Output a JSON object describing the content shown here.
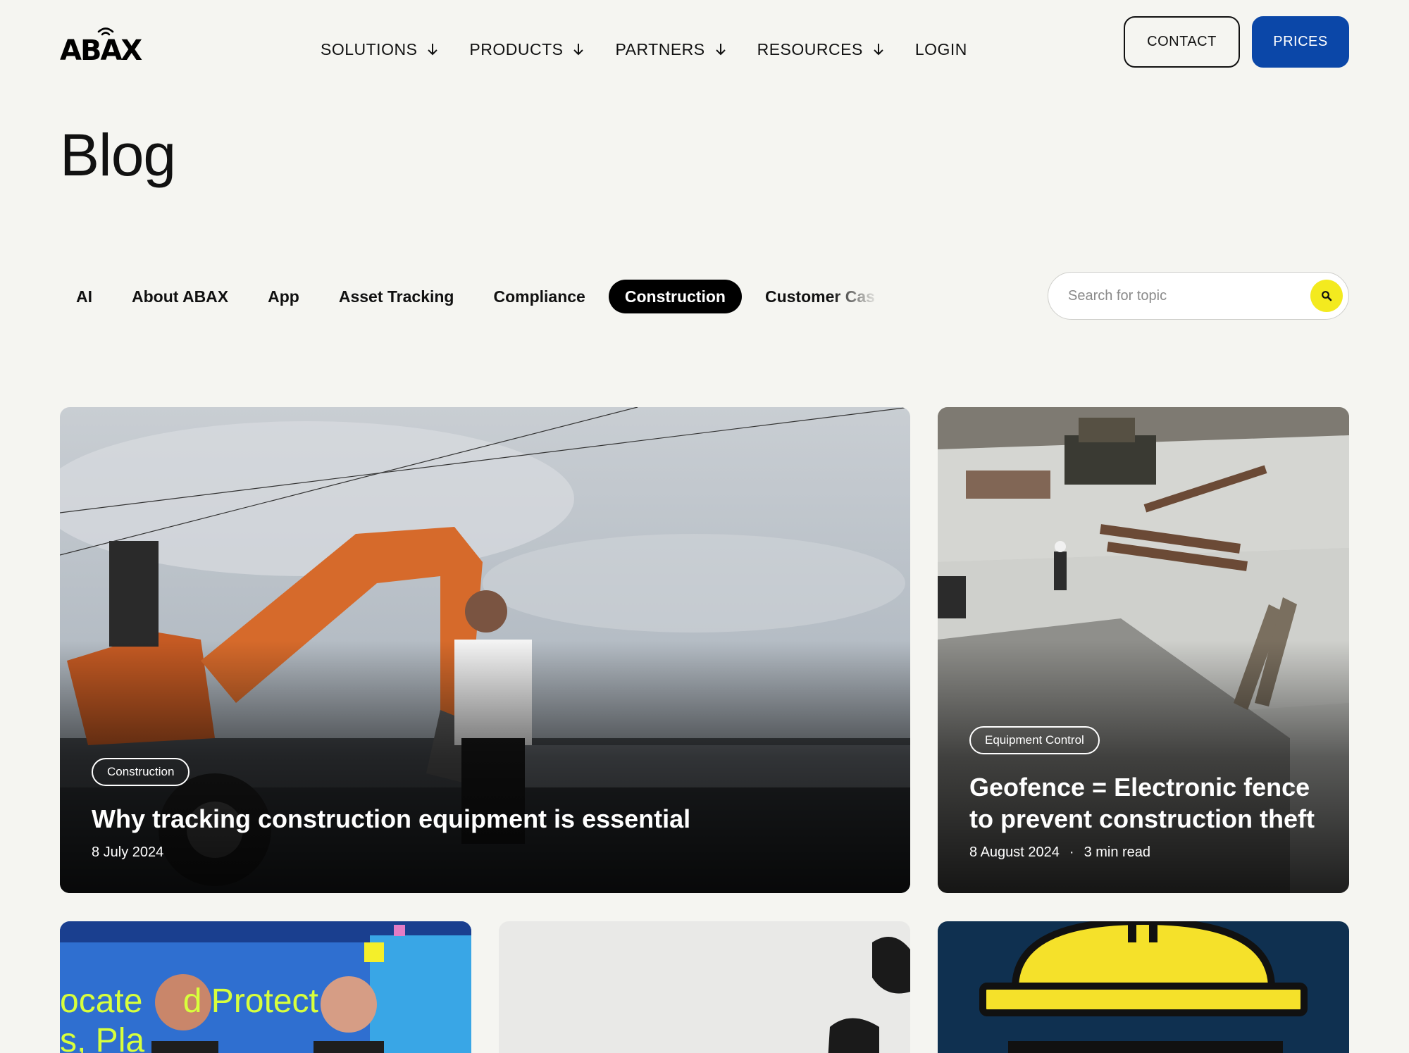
{
  "header": {
    "logo_text": "ABAX",
    "nav": [
      {
        "label": "SOLUTIONS",
        "has_dropdown": true
      },
      {
        "label": "PRODUCTS",
        "has_dropdown": true
      },
      {
        "label": "PARTNERS",
        "has_dropdown": true
      },
      {
        "label": "RESOURCES",
        "has_dropdown": true
      },
      {
        "label": "LOGIN",
        "has_dropdown": false
      }
    ],
    "contact_label": "CONTACT",
    "prices_label": "PRICES"
  },
  "page_title": "Blog",
  "categories": {
    "tabs": [
      "AI",
      "About ABAX",
      "App",
      "Asset Tracking",
      "Compliance",
      "Construction",
      "Customer Cas"
    ],
    "active": "Construction"
  },
  "search": {
    "placeholder": "Search for topic",
    "icon": "search-icon"
  },
  "featured_posts": [
    {
      "tag": "Construction",
      "title": "Why tracking construction equipment is essential",
      "date": "8 July 2024"
    },
    {
      "tag": "Equipment Control",
      "title": "Geofence = Electronic fence to prevent construction theft",
      "date": "8 August 2024",
      "separator": "·",
      "read_time": "3 min read"
    }
  ],
  "more_posts": {
    "card_1_image_text": [
      "ocate",
      "d Protect",
      "s, Pla"
    ]
  },
  "colors": {
    "background": "#f5f5f1",
    "brand_blue": "#0b47a8",
    "search_button_yellow": "#f3ea1f",
    "active_tab": "#000000"
  }
}
